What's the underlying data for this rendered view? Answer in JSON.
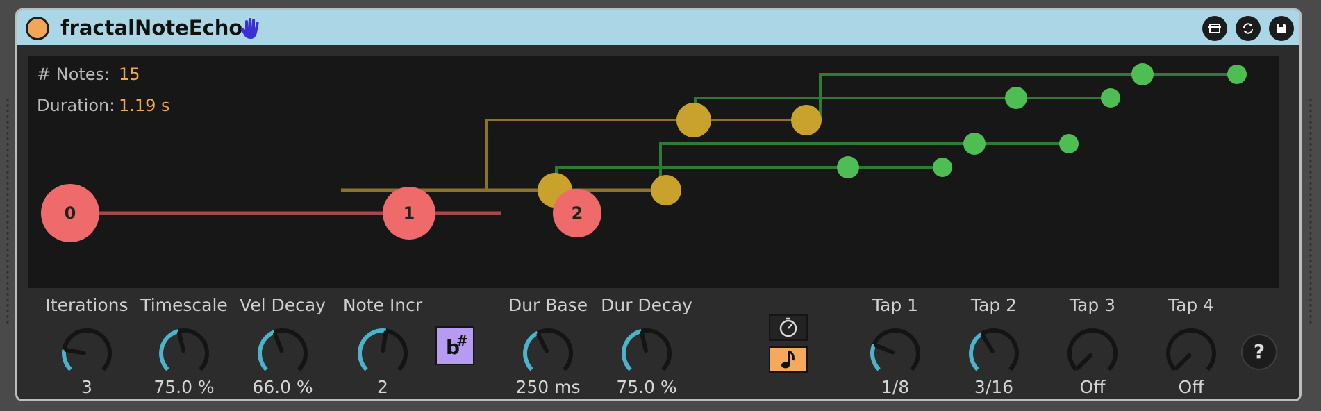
{
  "device": {
    "title": "fractalNoteEcho",
    "hand_icon": "hand-icon",
    "title_buttons": [
      "map-icon",
      "refresh-icon",
      "save-icon"
    ]
  },
  "stats": {
    "notes_label": "# Notes:",
    "notes_value": "15",
    "duration_label": "Duration:",
    "duration_value": "1.19 s"
  },
  "viz": {
    "root_nodes": [
      "0",
      "1",
      "2"
    ],
    "colors": {
      "level0": "#ef6b6b",
      "level1": "#c9a22e",
      "level2": "#4dbd54"
    }
  },
  "controls": [
    {
      "label": "Iterations",
      "value": "3",
      "level": 0.2
    },
    {
      "label": "Timescale",
      "value": "75.0 %",
      "level": 0.45
    },
    {
      "label": "Vel Decay",
      "value": "66.0 %",
      "level": 0.42
    },
    {
      "label": "Note Incr",
      "value": "2",
      "level": 0.53
    },
    {
      "label": "Dur Base",
      "value": "250 ms",
      "level": 0.4
    },
    {
      "label": "Dur Decay",
      "value": "75.0 %",
      "level": 0.45
    },
    {
      "label": "Tap 1",
      "value": "1/8",
      "level": 0.25
    },
    {
      "label": "Tap 2",
      "value": "3/16",
      "level": 0.38
    },
    {
      "label": "Tap 3",
      "value": "Off",
      "level": 0.0
    },
    {
      "label": "Tap 4",
      "value": "Off",
      "level": 0.0
    }
  ],
  "accidental_button": {
    "icon": "flat-sharp-icon"
  },
  "sync_buttons": {
    "time": "stopwatch-icon",
    "note": "eighth-note-icon",
    "active": "note"
  },
  "help": {
    "label": "?"
  },
  "accent": {
    "knob_arc": "#4bb4cc",
    "value_text": "#f0a94b"
  }
}
